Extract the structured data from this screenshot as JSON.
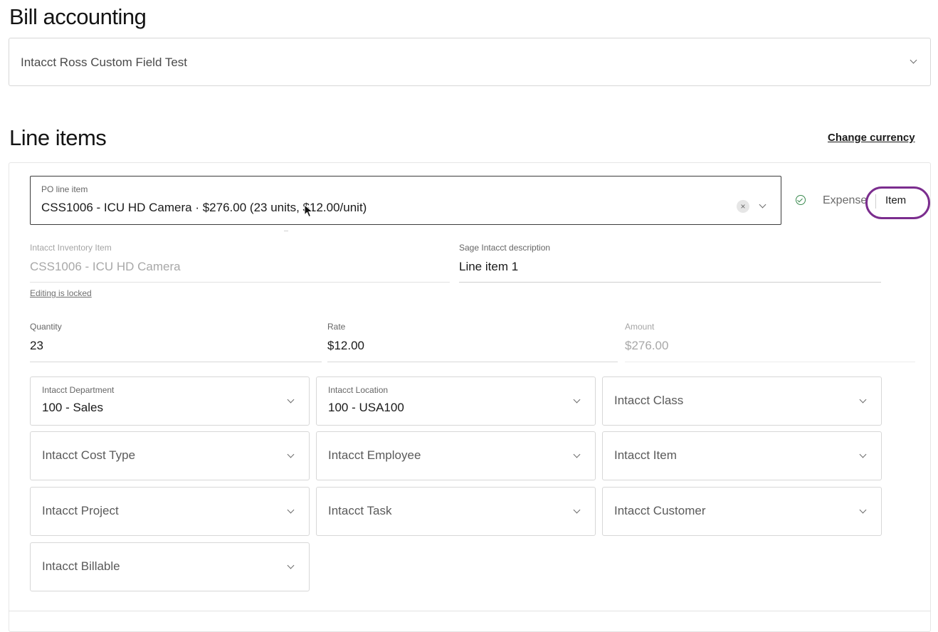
{
  "bill_accounting": {
    "heading": "Bill accounting",
    "select_value": "Intacct Ross Custom Field Test"
  },
  "line_items": {
    "heading": "Line items",
    "change_currency": "Change currency",
    "po_line_item": {
      "label": "PO line item",
      "value": "CSS1006 - ICU HD Camera · $276.00 (23 units, $12.00/unit)"
    },
    "toggle": {
      "expense": "Expense",
      "item": "Item"
    },
    "inventory_item": {
      "label": "Intacct Inventory Item",
      "value": "CSS1006 - ICU HD Camera",
      "note": "Editing is locked"
    },
    "description": {
      "label": "Sage Intacct description",
      "value": "Line item 1"
    },
    "quantity": {
      "label": "Quantity",
      "value": "23"
    },
    "rate": {
      "label": "Rate",
      "value": "$12.00"
    },
    "amount": {
      "label": "Amount",
      "value": "$276.00"
    },
    "dropdowns": {
      "department": {
        "label": "Intacct Department",
        "value": "100 - Sales"
      },
      "location": {
        "label": "Intacct Location",
        "value": "100 - USA100"
      },
      "class": {
        "placeholder": "Intacct Class"
      },
      "cost_type": {
        "placeholder": "Intacct Cost Type"
      },
      "employee": {
        "placeholder": "Intacct Employee"
      },
      "item": {
        "placeholder": "Intacct Item"
      },
      "project": {
        "placeholder": "Intacct Project"
      },
      "task": {
        "placeholder": "Intacct Task"
      },
      "customer": {
        "placeholder": "Intacct Customer"
      },
      "billable": {
        "placeholder": "Intacct Billable"
      }
    }
  },
  "colors": {
    "highlight_circle": "#7b2d8e",
    "check_green": "#3a8a4f"
  }
}
